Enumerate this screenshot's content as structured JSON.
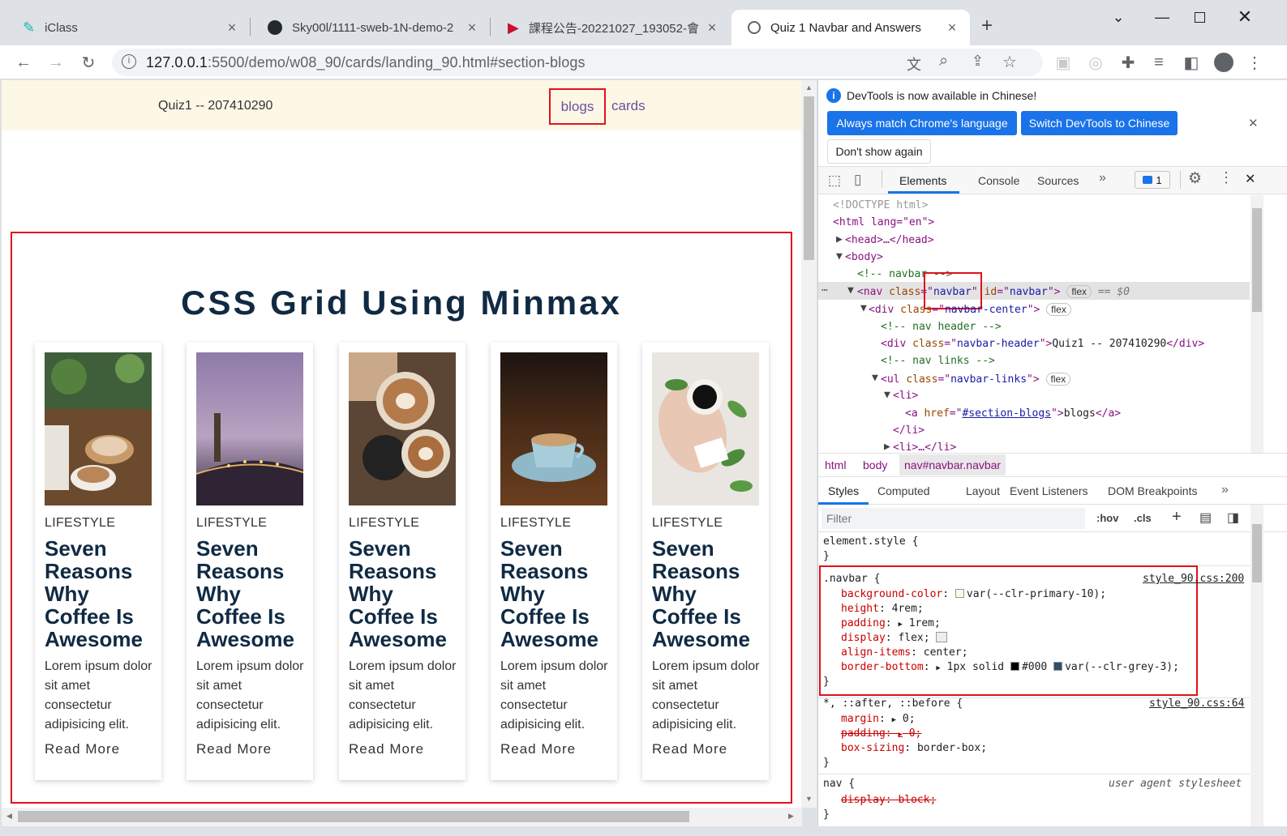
{
  "browser": {
    "tabs": [
      {
        "title": "iClass",
        "icon": "iclass-icon"
      },
      {
        "title": "Sky00l/1111-sweb-1N-demo-2",
        "icon": "github-icon"
      },
      {
        "title": "課程公告-20221027_193052-會",
        "icon": "play-icon"
      },
      {
        "title": "Quiz 1 Navbar and Answers",
        "icon": "globe-icon"
      }
    ],
    "url_host": "127.0.0.1",
    "url_rest": ":5500/demo/w08_90/cards/landing_90.html#section-blogs"
  },
  "page": {
    "navbar": {
      "brand": "Quiz1 -- 207410290",
      "link_blogs": "blogs",
      "link_cards": "cards"
    },
    "section_title": "CSS Grid Using Minmax",
    "cards": [
      {
        "category": "LIFESTYLE",
        "title": "Seven Reasons Why Coffee Is Awesome",
        "text": "Lorem ipsum dolor sit amet consectetur adipisicing elit.",
        "link": "Read More"
      },
      {
        "category": "LIFESTYLE",
        "title": "Seven Reasons Why Coffee Is Awesome",
        "text": "Lorem ipsum dolor sit amet consectetur adipisicing elit.",
        "link": "Read More"
      },
      {
        "category": "LIFESTYLE",
        "title": "Seven Reasons Why Coffee Is Awesome",
        "text": "Lorem ipsum dolor sit amet consectetur adipisicing elit.",
        "link": "Read More"
      },
      {
        "category": "LIFESTYLE",
        "title": "Seven Reasons Why Coffee Is Awesome",
        "text": "Lorem ipsum dolor sit amet consectetur adipisicing elit.",
        "link": "Read More"
      },
      {
        "category": "LIFESTYLE",
        "title": "Seven Reasons Why Coffee Is Awesome",
        "text": "Lorem ipsum dolor sit amet consectetur adipisicing elit.",
        "link": "Read More"
      }
    ]
  },
  "devtools": {
    "notice": "DevTools is now available in Chinese!",
    "btn_match": "Always match Chrome's language",
    "btn_switch": "Switch DevTools to Chinese",
    "btn_dont": "Don't show again",
    "tabs": [
      "Elements",
      "Console",
      "Sources"
    ],
    "issues_count": "1",
    "dom": {
      "doctype": "<!DOCTYPE html>",
      "html_open": "<html lang=\"en\">",
      "head": "<head>…</head>",
      "body": "<body>",
      "cmt_navbar": "<!-- navbar -->",
      "nav_tag": "nav",
      "nav_class": "navbar",
      "nav_id": "navbar",
      "flex": "flex",
      "eq": "== $0",
      "div_center_class": "navbar-center",
      "cmt_header": "<!-- nav header -->",
      "div_header_class": "navbar-header",
      "header_text": "Quiz1 -- 207410290",
      "cmt_links": "<!-- nav links -->",
      "ul_class": "navbar-links",
      "li_open": "<li>",
      "a_href": "#section-blogs",
      "a_text": "blogs",
      "li_close": "</li>",
      "li_collapsed": "<li>…</li>"
    },
    "breadcrumb": [
      "html",
      "body",
      "nav#navbar.navbar"
    ],
    "style_tabs": [
      "Styles",
      "Computed",
      "Layout",
      "Event Listeners",
      "DOM Breakpoints"
    ],
    "filter_placeholder": "Filter",
    "hov": ":hov",
    "cls": ".cls",
    "styles": {
      "element_style": "element.style {",
      "close": "}",
      "navbar_selector": ".navbar {",
      "navbar_source": "style_90.css:200",
      "bg_prop": "background-color",
      "bg_val": "var(--clr-primary-10);",
      "height_prop": "height",
      "height_val": "4rem;",
      "padding_prop": "padding",
      "padding_val": "1rem;",
      "display_prop": "display",
      "display_val": "flex;",
      "align_prop": "align-items",
      "align_val": "center;",
      "border_prop": "border-bottom",
      "border_val_a": "1px solid",
      "border_val_b": "#000",
      "border_val_c": "var(--clr-grey-3);",
      "universal_selector": "*, ::after, ::before {",
      "universal_source": "style_90.css:64",
      "margin_prop": "margin",
      "margin_val": "0;",
      "padding2_prop": "padding",
      "padding2_val": "0;",
      "boxsizing_prop": "box-sizing",
      "boxsizing_val": "border-box;",
      "nav_selector": "nav {",
      "nav_source": "user agent stylesheet",
      "display2_prop": "display",
      "display2_val": "block;"
    }
  },
  "colors": {
    "annotation_red": "#e0121b",
    "navbar_bg": "#fdf7e6",
    "devtools_blue": "#1a73e8"
  }
}
